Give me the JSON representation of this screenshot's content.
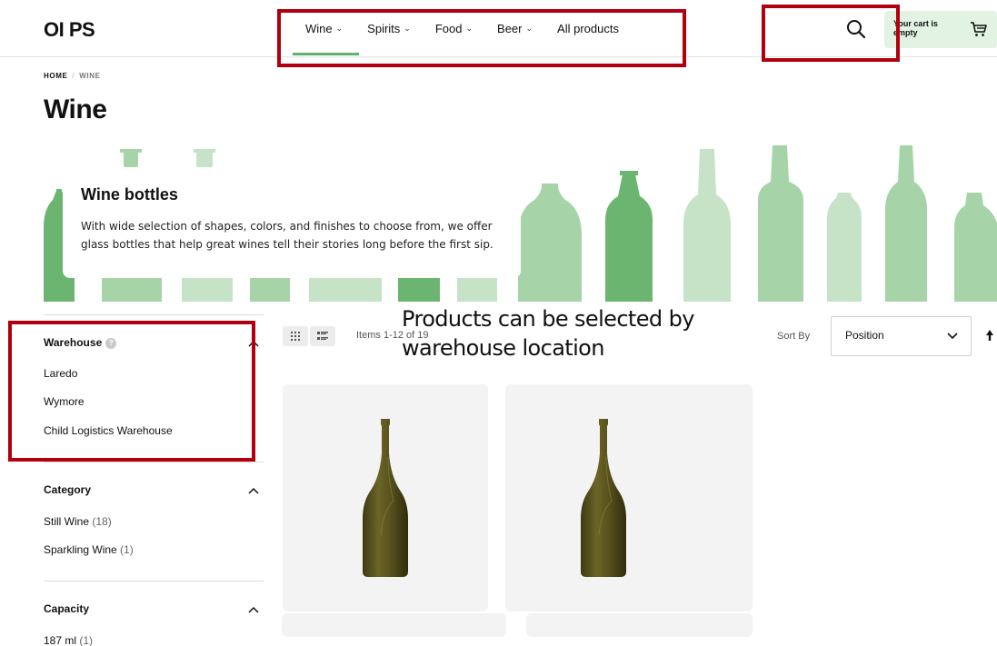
{
  "brand": {
    "logo_prefix": "O",
    "logo_text": "I PS"
  },
  "nav": {
    "items": [
      {
        "label": "Wine",
        "has_dropdown": true
      },
      {
        "label": "Spirits",
        "has_dropdown": true
      },
      {
        "label": "Food",
        "has_dropdown": true
      },
      {
        "label": "Beer",
        "has_dropdown": true
      },
      {
        "label": "All products",
        "has_dropdown": false
      }
    ],
    "active": "Wine"
  },
  "header": {
    "search_icon": "search-icon",
    "cart_text": "Your cart is empty",
    "cart_icon": "cart-icon"
  },
  "breadcrumb": {
    "home": "HOME",
    "separator": "/",
    "current": "WINE"
  },
  "page_title": "Wine",
  "banner": {
    "title": "Wine bottles",
    "description": "With wide selection of shapes, colors, and finishes to choose from, we offer glass bottles that help great wines tell their stories long before the first sip."
  },
  "annotation": {
    "text_line1": "Products can be selected by",
    "text_line2": "warehouse location"
  },
  "filters": {
    "warehouse": {
      "heading": "Warehouse",
      "help_icon": "help-icon",
      "items": [
        "Laredo",
        "Wymore",
        "Child Logistics Warehouse"
      ]
    },
    "category": {
      "heading": "Category",
      "items": [
        {
          "label": "Still Wine",
          "count": "(18)"
        },
        {
          "label": "Sparkling Wine",
          "count": "(1)"
        }
      ]
    },
    "capacity": {
      "heading": "Capacity",
      "items": [
        {
          "label": "187 ml",
          "count": "(1)"
        }
      ]
    }
  },
  "toolbar": {
    "grid_icon": "grid-view-icon",
    "list_icon": "list-view-icon",
    "items_count": "Items 1-12 of 19",
    "sort_label": "Sort By",
    "sort_value": "Position",
    "sort_direction_icon": "arrow-up-icon"
  },
  "colors": {
    "accent_green": "#5fb36a",
    "highlight_red": "#b0000f",
    "cart_bg": "#e2f3e3",
    "bottle_olive": "#5a5520"
  }
}
